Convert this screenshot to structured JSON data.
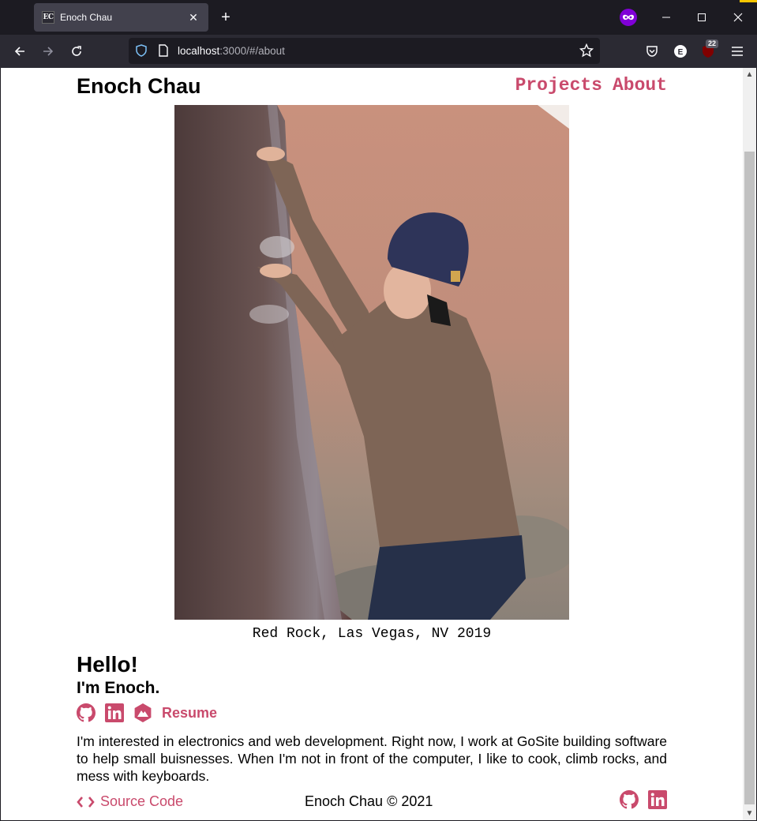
{
  "browser": {
    "tab_title": "Enoch Chau",
    "favicon_text": "EC",
    "url_host": "localhost",
    "url_rest": ":3000/#/about",
    "extension_badge": "22",
    "account_initial": "E"
  },
  "site": {
    "name": "Enoch Chau",
    "nav": [
      "Projects",
      "About"
    ],
    "accent_color": "#c94a6c"
  },
  "photo": {
    "caption": "Red Rock, Las Vegas, NV 2019"
  },
  "intro": {
    "greeting": "Hello!",
    "subheading": "I'm Enoch.",
    "resume_label": "Resume",
    "bio": "I'm interested in electronics and web development. Right now, I work at GoSite building software to help small buisnesses. When I'm not in front of the computer, I like to cook, climb rocks, and mess with keyboards."
  },
  "footer": {
    "source_label": "Source Code",
    "copyright": "Enoch Chau © 2021"
  },
  "icons": [
    "github-icon",
    "linkedin-icon",
    "mountain-badge-icon",
    "code-icon"
  ]
}
